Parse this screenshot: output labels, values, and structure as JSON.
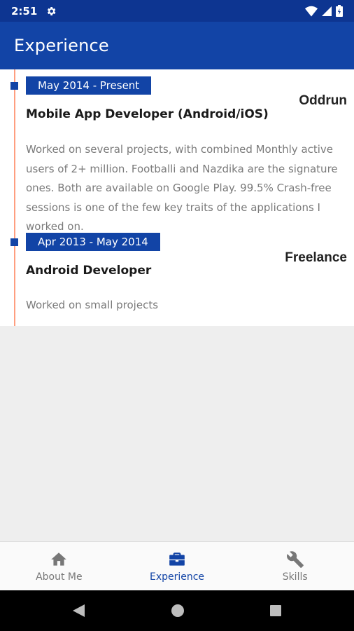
{
  "status_bar": {
    "time": "2:51",
    "icons": [
      "gear-icon",
      "wifi-icon",
      "signal-icon",
      "battery-icon"
    ]
  },
  "app_bar": {
    "title": "Experience"
  },
  "experience": [
    {
      "date": "May 2014 - Present",
      "company": "Oddrun",
      "role": "Mobile App Developer (Android/iOS)",
      "description": "Worked on several projects, with combined Monthly active users of 2+ million. Footballi and Nazdika are the signature ones. Both are available on Google Play. 99.5% Crash-free sessions is one of the few key traits of the applications I worked on."
    },
    {
      "date": "Apr 2013 - May 2014",
      "company": "Freelance",
      "role": "Android Developer",
      "description": "Worked on small projects"
    }
  ],
  "bottom_nav": {
    "items": [
      {
        "label": "About Me",
        "icon": "home-icon",
        "active": false
      },
      {
        "label": "Experience",
        "icon": "briefcase-icon",
        "active": true
      },
      {
        "label": "Skills",
        "icon": "wrench-icon",
        "active": false
      }
    ]
  },
  "colors": {
    "primary": "#1244a6",
    "status_bar": "#0d3591",
    "timeline": "#ff9e80",
    "inactive": "#777777"
  }
}
